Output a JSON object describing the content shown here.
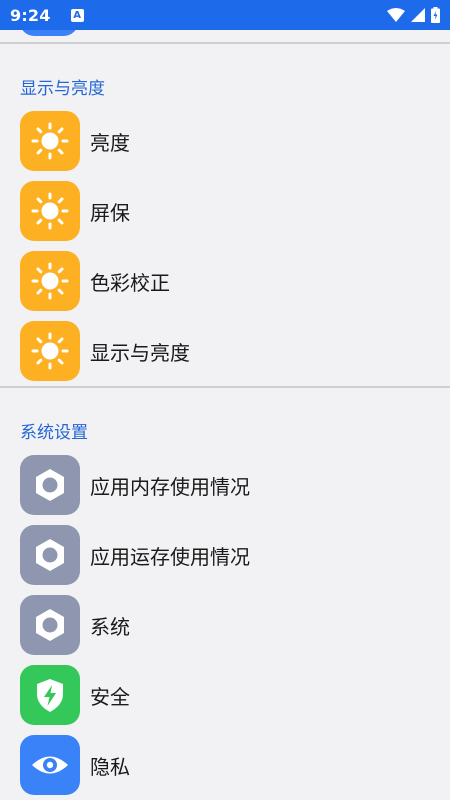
{
  "status_bar": {
    "time": "9:24",
    "notification_icon": "a-notification-icon",
    "icons": [
      "wifi-icon",
      "cell-signal-icon",
      "battery-charging-icon"
    ]
  },
  "sections": [
    {
      "header": "显示与亮度",
      "items": [
        {
          "label": "亮度",
          "icon": "sun-icon"
        },
        {
          "label": "屏保",
          "icon": "sun-icon"
        },
        {
          "label": "色彩校正",
          "icon": "sun-icon"
        },
        {
          "label": "显示与亮度",
          "icon": "sun-icon"
        }
      ]
    },
    {
      "header": "系统设置",
      "items": [
        {
          "label": "应用内存使用情况",
          "icon": "hex-nut-icon"
        },
        {
          "label": "应用运存使用情况",
          "icon": "hex-nut-icon"
        },
        {
          "label": "系统",
          "icon": "hex-nut-icon"
        },
        {
          "label": "安全",
          "icon": "shield-icon"
        },
        {
          "label": "隐私",
          "icon": "eye-icon"
        }
      ]
    }
  ],
  "colors": {
    "status_bar": "#1D6BEA",
    "section_header": "#2466D6",
    "sun_tile": "#FDB022",
    "gear_tile": "#8E96B0",
    "shield_tile": "#34C759",
    "eye_tile": "#3A82F7",
    "background": "#F2F2F4"
  }
}
